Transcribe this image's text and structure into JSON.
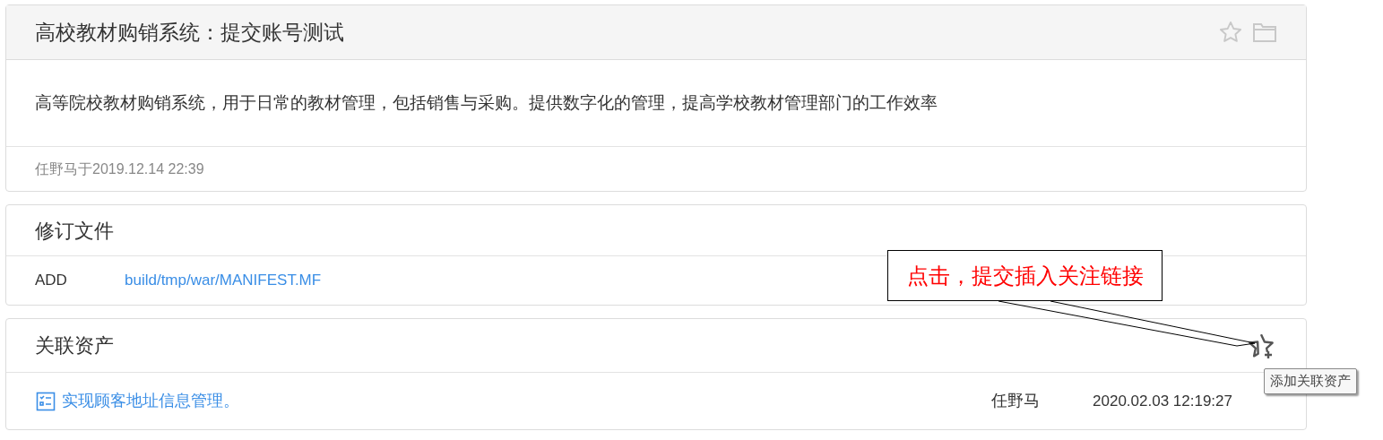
{
  "commit": {
    "title": "高校教材购销系统：提交账号测试",
    "description": "高等院校教材购销系统，用于日常的教材管理，包括销售与采购。提供数字化的管理，提高学校教材管理部门的工作效率",
    "meta": "任野马于2019.12.14 22:39"
  },
  "files": {
    "title": "修订文件",
    "rows": [
      {
        "action": "ADD",
        "path": "build/tmp/war/MANIFEST.MF"
      }
    ]
  },
  "assets": {
    "title": "关联资产",
    "rows": [
      {
        "name": "实现顾客地址信息管理。",
        "author": "任野马",
        "time": "2020.02.03 12:19:27"
      }
    ],
    "tooltip": "添加关联资产"
  },
  "callout": {
    "text": "点击，提交插入关注链接"
  }
}
